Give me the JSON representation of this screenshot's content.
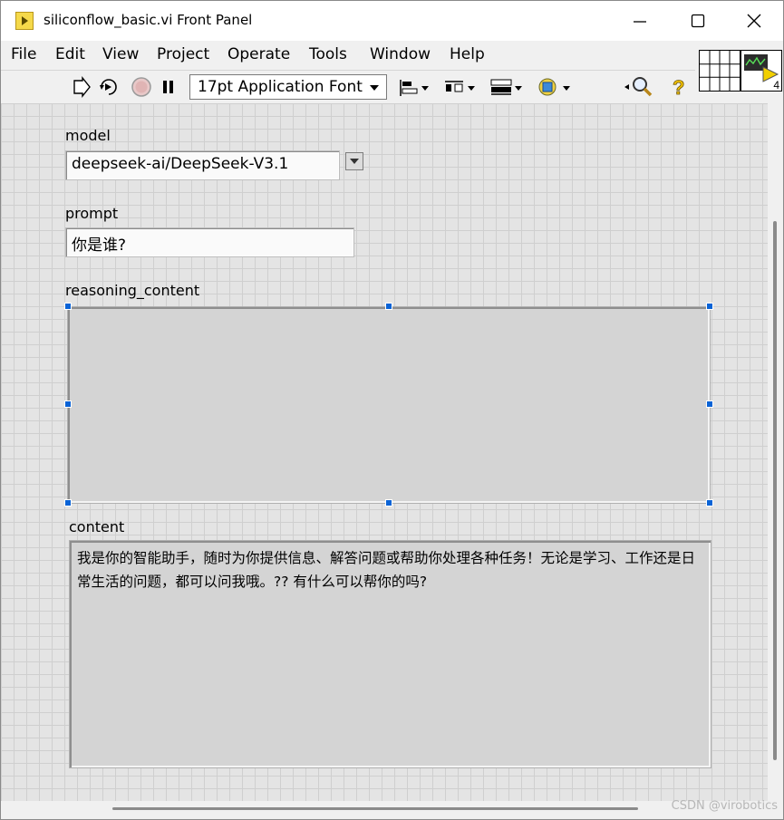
{
  "window": {
    "title": "siliconflow_basic.vi Front Panel"
  },
  "menu": [
    "File",
    "Edit",
    "View",
    "Project",
    "Operate",
    "Tools",
    "Window",
    "Help"
  ],
  "toolbar": {
    "font": "17pt Application Font",
    "connector_terminal_count": "4"
  },
  "controls": {
    "model": {
      "label": "model",
      "value": "deepseek-ai/DeepSeek-V3.1"
    },
    "prompt": {
      "label": "prompt",
      "value": "你是谁?"
    },
    "reasoning_content": {
      "label": "reasoning_content",
      "value": ""
    },
    "content": {
      "label": "content",
      "value": "我是你的智能助手，随时为你提供信息、解答问题或帮助你处理各种任务！无论是学习、工作还是日常生活的问题，都可以问我哦。?? 有什么可以帮你的吗?"
    }
  },
  "watermark": "CSDN @virobotics",
  "colors": {
    "selection_handle": "#0a63d6",
    "panel_grid": "#cfcfcf",
    "indicator_bg": "#d4d4d4"
  }
}
